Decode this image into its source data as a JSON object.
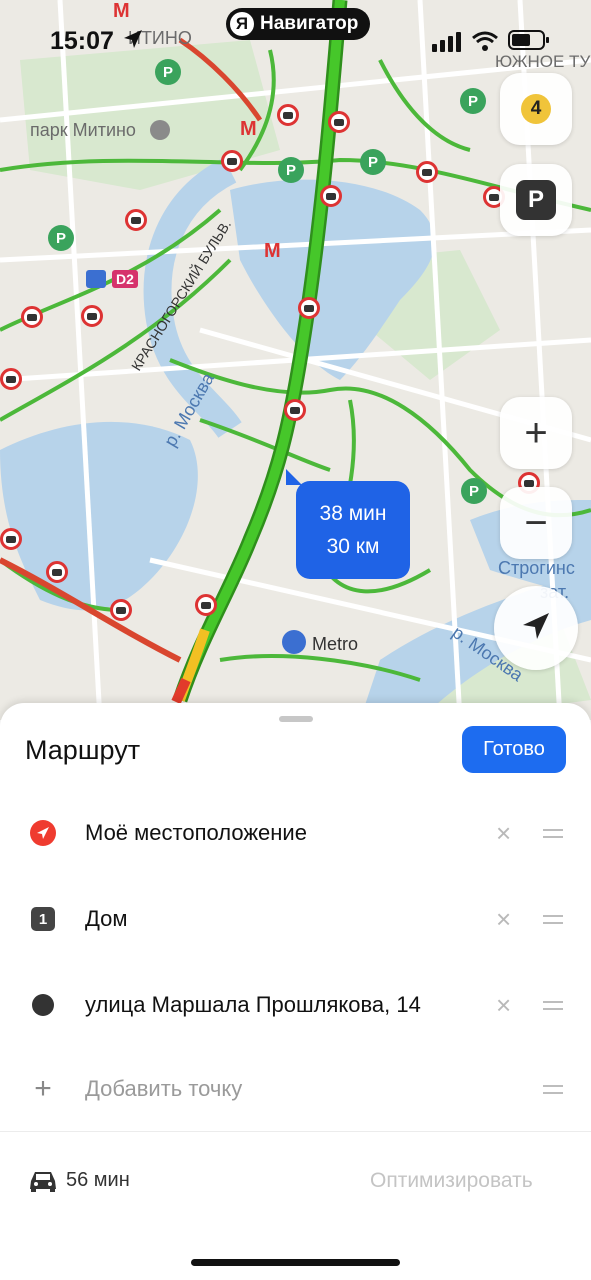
{
  "status_bar": {
    "time": "15:07",
    "app_pill": "Навигатор",
    "app_pill_logo": "Я"
  },
  "map": {
    "labels": {
      "park": "парк Митино",
      "district_top": "ИТИНО",
      "district_right": "ЮЖНОЕ ТУ",
      "boulevard": "КРАСНОГОРСКИЙ БУЛЬВ.",
      "river_left": "р. Москва",
      "river_right": "р. Москва",
      "store": "Metro",
      "strogino": "Строгинс",
      "strogino2": "зат.",
      "d2": "D2"
    },
    "route_bubble": {
      "duration": "38 мин",
      "distance": "30 км"
    },
    "buttons": {
      "traffic_level": "4",
      "parking": "P",
      "zoom_in": "+",
      "zoom_out": "−"
    },
    "colors": {
      "route_green": "#3fbf2a",
      "route_yellow": "#f2c023",
      "route_red": "#e23b2b",
      "water": "#b7d3ea"
    }
  },
  "sheet": {
    "title": "Маршрут",
    "done_button": "Готово",
    "waypoints": [
      {
        "icon": "location-arrow-icon",
        "label": "Моё местоположение",
        "remove": "×"
      },
      {
        "icon": "number-badge-icon",
        "badge": "1",
        "label": "Дом",
        "remove": "×"
      },
      {
        "icon": "destination-dot-icon",
        "label": "улица Маршала Прошлякова, 14",
        "remove": "×"
      }
    ],
    "add_point": {
      "icon": "plus-icon",
      "label": "Добавить точку"
    },
    "footer": {
      "duration": "56 мин",
      "optimize_label": "Оптимизировать"
    }
  }
}
